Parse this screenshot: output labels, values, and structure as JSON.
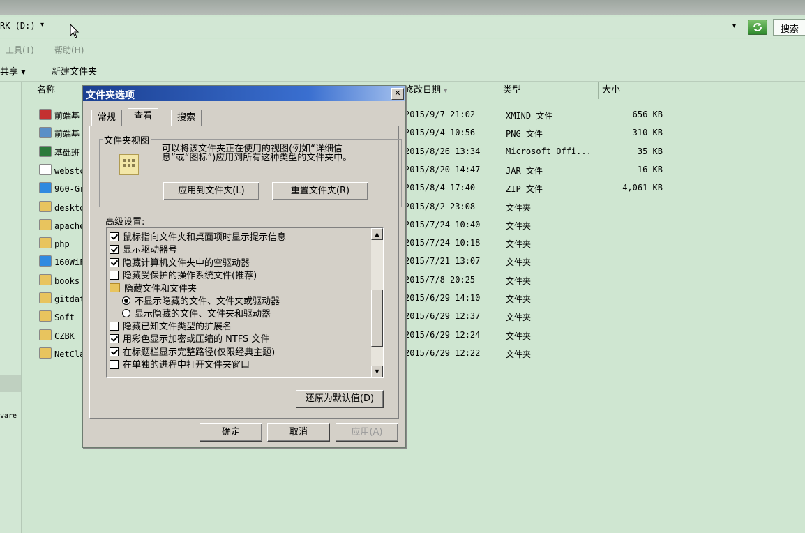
{
  "window": {
    "address_path": "RK (D:)",
    "search_label": "搜索"
  },
  "menu": {
    "tools": "工具(T)",
    "help": "帮助(H)"
  },
  "toolbar": {
    "share": "共享 ▾",
    "new_folder": "新建文件夹"
  },
  "columns": {
    "name": "名称",
    "modified": "修改日期",
    "type": "类型",
    "size": "大小"
  },
  "nav": {
    "partial_label": "vare"
  },
  "files": [
    {
      "name": "前端基",
      "date": "2015/9/7 21:02",
      "type": "XMIND 文件",
      "size": "656 KB",
      "icon_color": "#c43030"
    },
    {
      "name": "前端基",
      "date": "2015/9/4 10:56",
      "type": "PNG 文件",
      "size": "310 KB",
      "icon_color": "#5a8fc7"
    },
    {
      "name": "基础班",
      "date": "2015/8/26 13:34",
      "type": "Microsoft Offi...",
      "size": "35 KB",
      "icon_color": "#2b7a3a"
    },
    {
      "name": "webstc",
      "date": "2015/8/20 14:47",
      "type": "JAR 文件",
      "size": "16 KB",
      "icon_color": "#ffffff"
    },
    {
      "name": "960-Gr",
      "date": "2015/8/4 17:40",
      "type": "ZIP 文件",
      "size": "4,061 KB",
      "icon_color": "#2f8ae0"
    },
    {
      "name": "deskto",
      "date": "2015/8/2 23:08",
      "type": "文件夹",
      "size": "",
      "icon_color": "#e8c45e"
    },
    {
      "name": "apache",
      "date": "2015/7/24 10:40",
      "type": "文件夹",
      "size": "",
      "icon_color": "#e8c45e"
    },
    {
      "name": "php",
      "date": "2015/7/24 10:18",
      "type": "文件夹",
      "size": "",
      "icon_color": "#e8c45e"
    },
    {
      "name": "160WiF",
      "date": "2015/7/21 13:07",
      "type": "文件夹",
      "size": "",
      "icon_color": "#2f8ae0"
    },
    {
      "name": "books",
      "date": "2015/7/8 20:25",
      "type": "文件夹",
      "size": "",
      "icon_color": "#e8c45e"
    },
    {
      "name": "gitdat",
      "date": "2015/6/29 14:10",
      "type": "文件夹",
      "size": "",
      "icon_color": "#e8c45e"
    },
    {
      "name": "Soft",
      "date": "2015/6/29 12:37",
      "type": "文件夹",
      "size": "",
      "icon_color": "#e8c45e"
    },
    {
      "name": "CZBK",
      "date": "2015/6/29 12:24",
      "type": "文件夹",
      "size": "",
      "icon_color": "#e8c45e"
    },
    {
      "name": "NetCla",
      "date": "2015/6/29 12:22",
      "type": "文件夹",
      "size": "",
      "icon_color": "#e8c45e"
    }
  ],
  "dialog": {
    "title": "文件夹选项",
    "tabs": [
      "常规",
      "查看",
      "搜索"
    ],
    "folder_views_legend": "文件夹视图",
    "folder_views_desc": "可以将该文件夹正在使用的视图(例如“详细信息”或“图标”)应用到所有这种类型的文件夹中。",
    "apply_to_folders": "应用到文件夹(L)",
    "reset_folders": "重置文件夹(R)",
    "advanced_label": "高级设置:",
    "options": [
      {
        "kind": "check",
        "checked": true,
        "label": "鼠标指向文件夹和桌面项时显示提示信息"
      },
      {
        "kind": "check",
        "checked": true,
        "label": "显示驱动器号"
      },
      {
        "kind": "check",
        "checked": true,
        "label": "隐藏计算机文件夹中的空驱动器"
      },
      {
        "kind": "check",
        "checked": false,
        "label": "隐藏受保护的操作系统文件(推荐)"
      },
      {
        "kind": "folder",
        "label": "隐藏文件和文件夹"
      },
      {
        "kind": "radio",
        "checked": true,
        "label": "不显示隐藏的文件、文件夹或驱动器"
      },
      {
        "kind": "radio",
        "checked": false,
        "label": "显示隐藏的文件、文件夹和驱动器"
      },
      {
        "kind": "check",
        "checked": false,
        "label": "隐藏已知文件类型的扩展名"
      },
      {
        "kind": "check",
        "checked": true,
        "label": "用彩色显示加密或压缩的 NTFS 文件"
      },
      {
        "kind": "check",
        "checked": true,
        "label": "在标题栏显示完整路径(仅限经典主题)"
      },
      {
        "kind": "check",
        "checked": false,
        "label": "在单独的进程中打开文件夹窗口"
      }
    ],
    "restore_defaults": "还原为默认值(D)",
    "ok": "确定",
    "cancel": "取消",
    "apply": "应用(A)"
  }
}
